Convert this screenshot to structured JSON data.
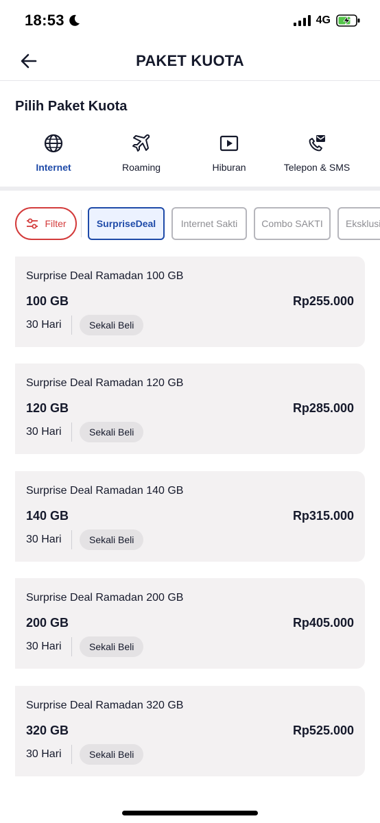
{
  "status_bar": {
    "time": "18:53",
    "network": "4G"
  },
  "header": {
    "title": "PAKET KUOTA"
  },
  "section_title": "Pilih Paket Kuota",
  "categories": [
    {
      "label": "Internet",
      "icon": "globe-icon",
      "active": true
    },
    {
      "label": "Roaming",
      "icon": "airplane-icon",
      "active": false
    },
    {
      "label": "Hiburan",
      "icon": "play-icon",
      "active": false
    },
    {
      "label": "Telepon & SMS",
      "icon": "phone-message-icon",
      "active": false
    }
  ],
  "filters": {
    "filter_label": "Filter",
    "chips": [
      "SurpriseDeal",
      "Internet Sakti",
      "Combo SAKTI",
      "Eksklusif"
    ],
    "selected": "SurpriseDeal"
  },
  "packages": [
    {
      "name": "Surprise Deal Ramadan 100 GB",
      "quota": "100 GB",
      "price": "Rp255.000",
      "duration": "30 Hari",
      "badge": "Sekali Beli"
    },
    {
      "name": "Surprise Deal Ramadan 120 GB",
      "quota": "120 GB",
      "price": "Rp285.000",
      "duration": "30 Hari",
      "badge": "Sekali Beli"
    },
    {
      "name": "Surprise Deal Ramadan 140 GB",
      "quota": "140 GB",
      "price": "Rp315.000",
      "duration": "30 Hari",
      "badge": "Sekali Beli"
    },
    {
      "name": "Surprise Deal Ramadan 200 GB",
      "quota": "200 GB",
      "price": "Rp405.000",
      "duration": "30 Hari",
      "badge": "Sekali Beli"
    },
    {
      "name": "Surprise Deal Ramadan 320 GB",
      "quota": "320 GB",
      "price": "Rp525.000",
      "duration": "30 Hari",
      "badge": "Sekali Beli"
    }
  ],
  "colors": {
    "accent": "#1e4aa8",
    "filter_red": "#d33b3b",
    "card_bg": "#f3f1f2"
  }
}
